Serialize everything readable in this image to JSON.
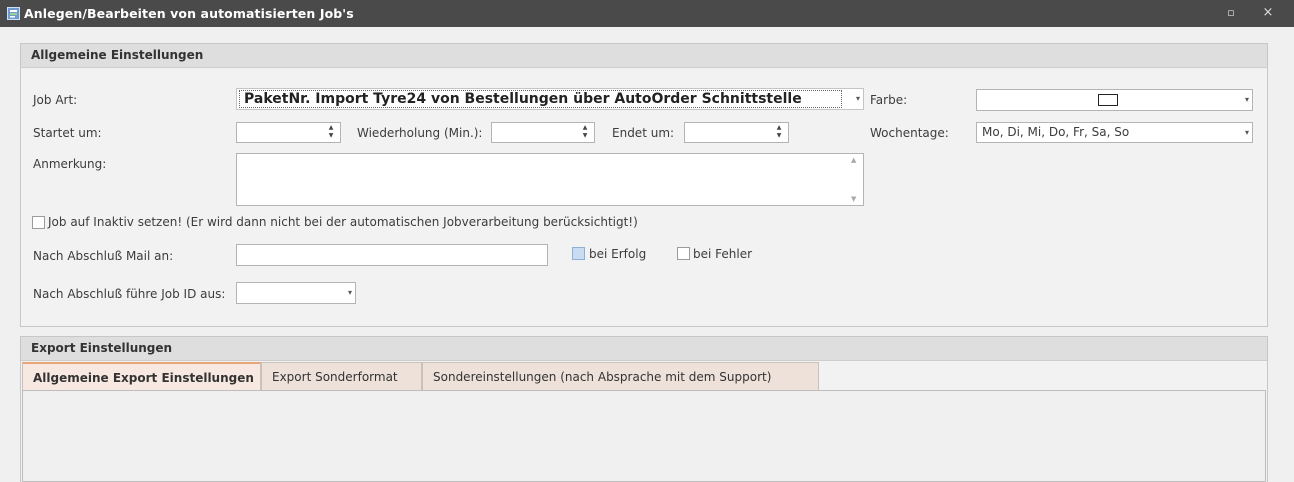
{
  "window": {
    "title": "Anlegen/Bearbeiten von automatisierten Job's",
    "maximize_icon": "▫",
    "close_icon": "×"
  },
  "general": {
    "header": "Allgemeine Einstellungen",
    "job_art": {
      "label": "Job Art:",
      "value": "PaketNr. Import Tyre24 von Bestellungen über AutoOrder Schnittstelle"
    },
    "farbe": {
      "label": "Farbe:"
    },
    "startet_um": {
      "label": "Startet um:",
      "value": ""
    },
    "wiederholung": {
      "label": "Wiederholung (Min.):",
      "value": ""
    },
    "endet_um": {
      "label": "Endet um:",
      "value": ""
    },
    "wochentage": {
      "label": "Wochentage:",
      "value": "Mo, Di, Mi, Do, Fr, Sa, So"
    },
    "anmerkung": {
      "label": "Anmerkung:",
      "value": ""
    },
    "inaktiv": {
      "label": "Job auf Inaktiv setzen! (Er wird dann nicht bei der automatischen Jobverarbeitung berücksichtigt!)",
      "checked": false
    },
    "mail": {
      "label": "Nach Abschluß Mail an:",
      "value": ""
    },
    "bei_erfolg": {
      "label": "bei Erfolg",
      "checked": false
    },
    "bei_fehler": {
      "label": "bei Fehler",
      "checked": false
    },
    "followup": {
      "label": "Nach Abschluß führe Job ID aus:",
      "value": ""
    }
  },
  "export": {
    "header": "Export Einstellungen",
    "tabs": [
      {
        "label": "Allgemeine Export Einstellungen",
        "active": true
      },
      {
        "label": "Export Sonderformat",
        "active": false
      },
      {
        "label": "Sondereinstellungen (nach Absprache mit dem Support)",
        "active": false
      }
    ]
  },
  "icons": {
    "dropdown": "▾",
    "spin_up": "▲",
    "spin_down": "▼"
  },
  "colors": {
    "titlebar": "#4a4a4a",
    "active_tab_accent": "#e8a57a",
    "checkbox_highlight": "#c9dcf1"
  }
}
